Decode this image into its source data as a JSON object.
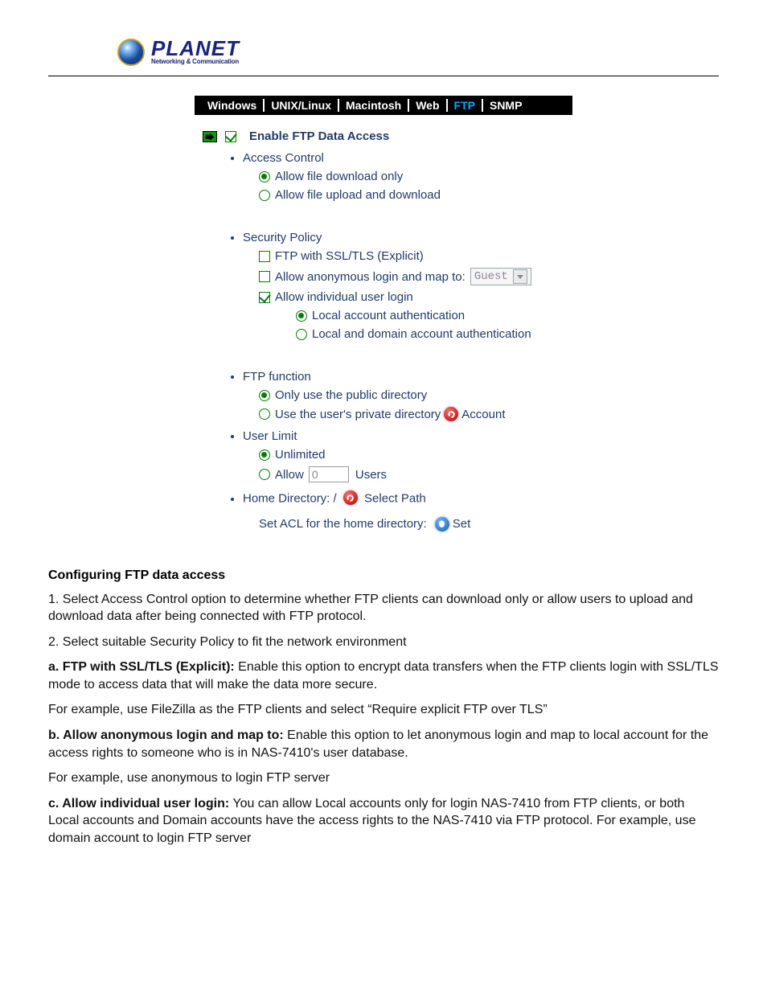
{
  "logo": {
    "name": "PLANET",
    "tagline": "Networking & Communication"
  },
  "tabs": [
    "Windows",
    "UNIX/Linux",
    "Macintosh",
    "Web",
    "FTP",
    "SNMP"
  ],
  "active_tab_index": 4,
  "ftp": {
    "enable_label": "Enable FTP Data Access",
    "enable_checked": true,
    "access": {
      "title": "Access Control",
      "download_only": "Allow file download only",
      "upload_download": "Allow file upload and download",
      "selected": "download_only"
    },
    "security": {
      "title": "Security Policy",
      "ssl_label": "FTP with SSL/TLS (Explicit)",
      "ssl_checked": false,
      "anon_label": "Allow anonymous login and map to:",
      "anon_checked": false,
      "anon_select": "Guest",
      "indiv_label": "Allow individual user login",
      "indiv_checked": true,
      "auth_local": "Local account authentication",
      "auth_both": "Local and domain account authentication",
      "auth_selected": "local"
    },
    "function": {
      "title": "FTP function",
      "public_only": "Only use the public directory",
      "private_dir": "Use the user's private directory",
      "account_link": "Account",
      "selected": "public_only"
    },
    "user_limit": {
      "title": "User Limit",
      "unlimited": "Unlimited",
      "allow_prefix": "Allow",
      "allow_value": "0",
      "allow_suffix": "Users",
      "selected": "unlimited"
    },
    "home": {
      "label": "Home Directory: /",
      "select_path": "Select Path",
      "acl_label": "Set ACL for the home directory:",
      "set_btn": "Set"
    }
  },
  "doc": {
    "heading": "Configuring FTP data access",
    "p1": "1. Select Access Control option to determine whether FTP clients can download only or allow users to upload and download data after being connected with FTP protocol.",
    "p2": "2. Select suitable Security Policy to fit the network environment",
    "p3a_b": "a. FTP with SSL/TLS (Explicit):",
    "p3a_t": " Enable this option to encrypt data transfers when the FTP clients login with SSL/TLS mode to access data that will make the data more secure.",
    "p3ex": "For example, use FileZilla as the FTP clients and select “Require explicit FTP over TLS”",
    "p4b_b": "b. Allow anonymous login and map to:",
    "p4b_t": " Enable this option to let anonymous login and map to local account for the access rights to someone who is in NAS-7410's user database.",
    "p4ex": "For example, use anonymous to login FTP server",
    "p5c_b": "c. Allow individual user login:",
    "p5c_t": " You can allow Local accounts only for login NAS-7410 from FTP clients, or both Local accounts and Domain accounts have the access rights to the NAS-7410 via FTP protocol. For example, use domain account to login FTP server"
  }
}
